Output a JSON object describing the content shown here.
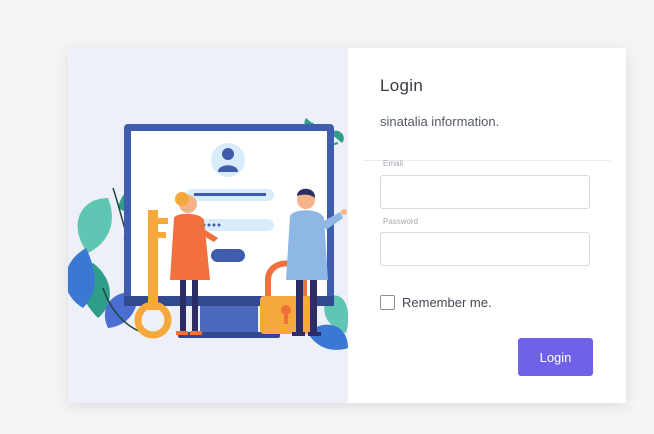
{
  "login_card": {
    "title": "Login",
    "subtitle": "sinatalia information.",
    "email": {
      "label": "Email",
      "value": "",
      "placeholder": ""
    },
    "password": {
      "label": "Password",
      "value": "",
      "placeholder": ""
    },
    "remember_label": "Remember me.",
    "remember_checked": false,
    "login_button_label": "Login"
  },
  "illustration": {
    "icons": [
      "monitor-icon",
      "user-avatar-icon",
      "key-icon",
      "padlock-icon"
    ],
    "accent_color": "#f2703e",
    "monitor_color": "#3f5cad"
  },
  "colors": {
    "primary_button": "#6e63e8",
    "illustration_bg": "#edf0f6",
    "page_bg": "#f5f5f7"
  }
}
